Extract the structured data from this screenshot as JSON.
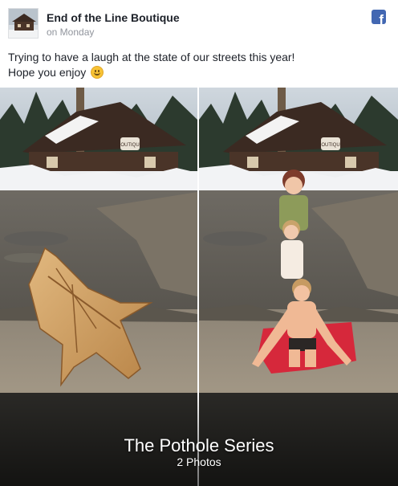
{
  "post": {
    "page_name": "End of the Line Boutique",
    "timestamp": "on Monday",
    "text_line1": "Trying to have a laugh at the state of our streets this year!",
    "text_line2": "Hope you enjoy",
    "emoji": "smiling-face-emoji"
  },
  "brand": {
    "facebook_letter": "f",
    "facebook_color": "#4267b2"
  },
  "sign": {
    "store_sign": "BOUTIQUE"
  },
  "album": {
    "title": "The Pothole Series",
    "count": "2 Photos",
    "photos": [
      {
        "subject": "wooden-shark-toy-in-pothole"
      },
      {
        "subject": "children-on-red-sled-in-pothole"
      }
    ]
  }
}
